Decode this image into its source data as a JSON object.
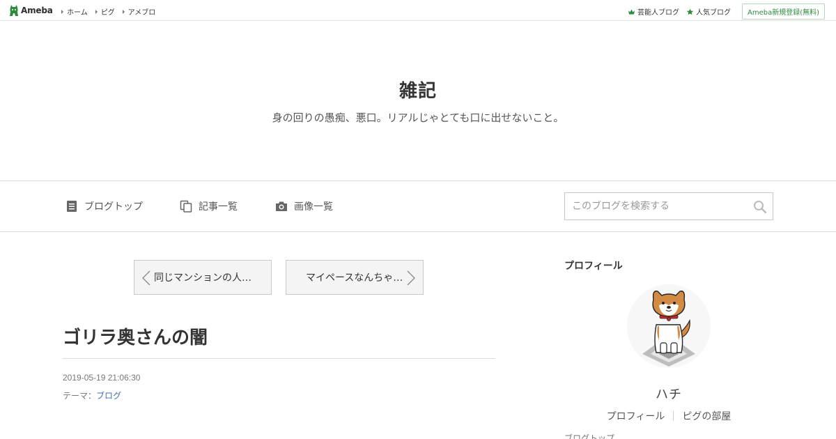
{
  "topbar": {
    "logo_text": "Ameba",
    "nav": [
      {
        "label": "ホーム"
      },
      {
        "label": "ピグ"
      },
      {
        "label": "アメブロ"
      }
    ],
    "right_links": [
      {
        "label": "芸能人ブログ",
        "icon": "crown-icon"
      },
      {
        "label": "人気ブログ",
        "icon": "star-icon"
      }
    ],
    "register_label": "Ameba新規登録(無料)",
    "accent_color": "#2d8a3e"
  },
  "blog": {
    "title": "雑記",
    "description": "身の回りの愚痴、悪口。リアルじゃとても口に出せないこと。"
  },
  "blog_nav": {
    "items": [
      {
        "label": "ブログトップ",
        "icon": "document-icon"
      },
      {
        "label": "記事一覧",
        "icon": "copy-icon"
      },
      {
        "label": "画像一覧",
        "icon": "camera-icon"
      }
    ],
    "search_placeholder": "このブログを検索する"
  },
  "pager": {
    "prev_label": "同じマンションの人…",
    "next_label": "マイペースなんちゃ…"
  },
  "entry": {
    "title": "ゴリラ奥さんの闇",
    "date": "2019-05-19 21:06:30",
    "theme_prefix": "テーマ：",
    "theme_link": "ブログ",
    "link_color": "#3b6fb6"
  },
  "sidebar": {
    "heading": "プロフィール",
    "name": "ハチ",
    "links": [
      {
        "label": "プロフィール"
      },
      {
        "label": "ピグの部屋"
      }
    ],
    "cut_text": "ブログトップ"
  }
}
